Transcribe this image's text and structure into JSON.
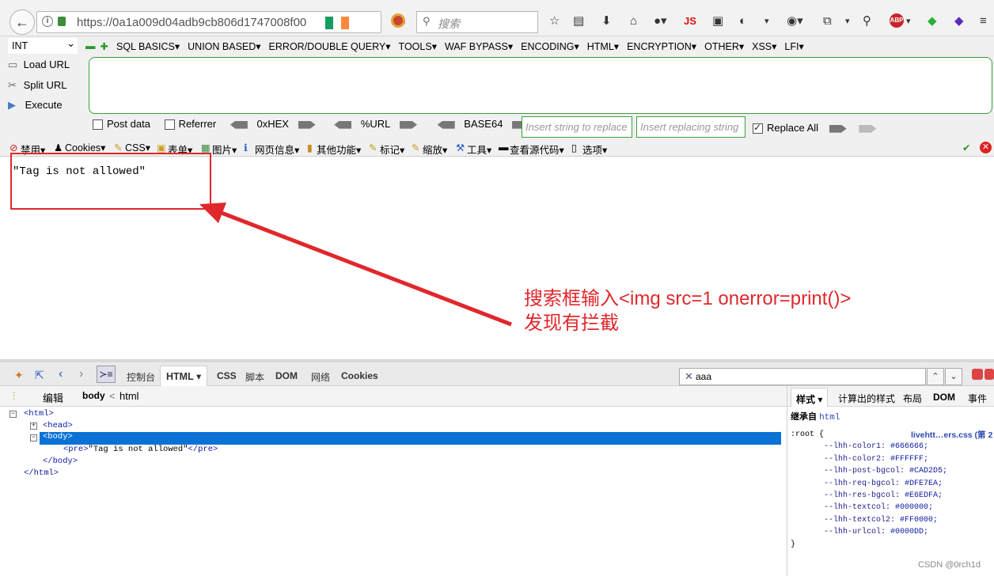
{
  "browser": {
    "url": "https://0a1a009d04adb9cb806d1747008f00",
    "search_placeholder": "搜索",
    "js_label": "JS",
    "flag_colors": [
      "#169b62",
      "#ffffff",
      "#ff883e"
    ],
    "icons": [
      "back-icon",
      "info-icon",
      "lock-icon",
      "reload-icon",
      "search-icon",
      "star-icon",
      "reading-list-icon",
      "download-icon",
      "home-icon",
      "user-icon"
    ]
  },
  "hackbar": {
    "select_value": "INT",
    "menus": [
      "SQL BASICS▾",
      "UNION BASED▾",
      "ERROR/DOUBLE QUERY▾",
      "TOOLS▾",
      "WAF BYPASS▾",
      "ENCODING▾",
      "HTML▾",
      "ENCRYPTION▾",
      "OTHER▾",
      "XSS▾",
      "LFI▾"
    ],
    "load_url": "Load URL",
    "split_url": "Split URL",
    "execute": "Execute",
    "url_value": "",
    "post_data": "Post data",
    "referrer": "Referrer",
    "hex": "0xHEX",
    "urlenc": "%URL",
    "base64": "BASE64",
    "insert_placeholder": "Insert string to replace",
    "replacing_placeholder": "Insert replacing string",
    "replace_all": "Replace All",
    "replace_all_checked": true
  },
  "webdev_toolbar": [
    "禁用▾",
    "Cookies▾",
    "CSS▾",
    "表单▾",
    "图片▾",
    "网页信息▾",
    "其他功能▾",
    "标记▾",
    "缩放▾",
    "工具▾",
    "查看源代码▾",
    "选项▾"
  ],
  "page": {
    "content": "\"Tag is not allowed\""
  },
  "annotation": {
    "line1": "搜索框输入<img src=1 onerror=print()>",
    "line2": "发现有拦截",
    "color": "#e0282c"
  },
  "devtools": {
    "tabs": [
      "控制台",
      "HTML ▾",
      "CSS",
      "脚本",
      "DOM",
      "网络",
      "Cookies"
    ],
    "active_tab": "HTML ▾",
    "search_value": "aaa",
    "edit": "编辑",
    "crumb_body": "body",
    "crumb_sep": "<",
    "crumb_html": "html",
    "tree": {
      "html_open": "<html>",
      "head": "<head>",
      "body_open": "<body>",
      "pre_open": "<pre>",
      "pre_text": "\"Tag is not allowed\"",
      "pre_close": "</pre>",
      "body_close": "</body>",
      "html_close": "</html>"
    },
    "right_tabs": [
      "样式 ▾",
      "计算出的样式",
      "布局",
      "DOM",
      "事件"
    ],
    "inherited_label": "继承自",
    "inherited_link": "html",
    "source_link": "livehtt…ers.css (第 2",
    "root_selector": ":root {",
    "css_vars": [
      {
        "name": "--lhh-color1:",
        "value": "#666666;"
      },
      {
        "name": "--lhh-color2:",
        "value": "#FFFFFF;"
      },
      {
        "name": "--lhh-post-bgcol:",
        "value": "#CAD2D5;"
      },
      {
        "name": "--lhh-req-bgcol:",
        "value": "#DFE7EA;"
      },
      {
        "name": "--lhh-res-bgcol:",
        "value": "#E6EDFA;"
      },
      {
        "name": "--lhh-textcol:",
        "value": "#000000;"
      },
      {
        "name": "--lhh-textcol2:",
        "value": "#FF0000;"
      },
      {
        "name": "--lhh-urlcol:",
        "value": "#0000DD;"
      }
    ],
    "root_close": "}"
  },
  "watermark": "CSDN @0rch1d"
}
